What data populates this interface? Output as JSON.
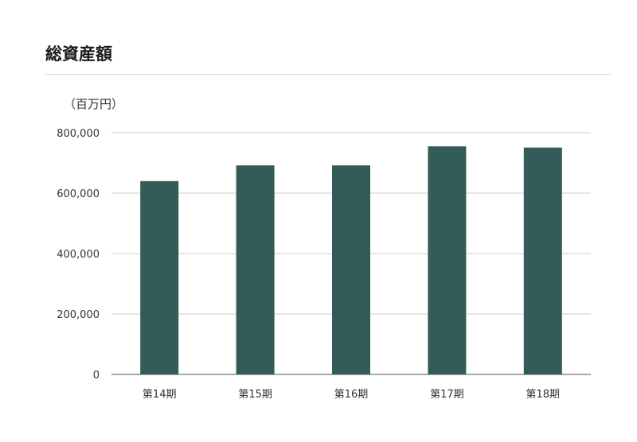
{
  "chart_data": {
    "type": "bar",
    "title": "総資産額",
    "unit_label": "（百万円）",
    "categories": [
      "第14期",
      "第15期",
      "第16期",
      "第17期",
      "第18期"
    ],
    "values": [
      640000,
      692000,
      692000,
      755000,
      751000
    ],
    "ylim": [
      0,
      800000
    ],
    "yticks": [
      "0",
      "200,000",
      "400,000",
      "600,000",
      "800,000"
    ],
    "ytick_values": [
      0,
      200000,
      400000,
      600000,
      800000
    ],
    "grid": true,
    "bar_color": "#335c58"
  }
}
